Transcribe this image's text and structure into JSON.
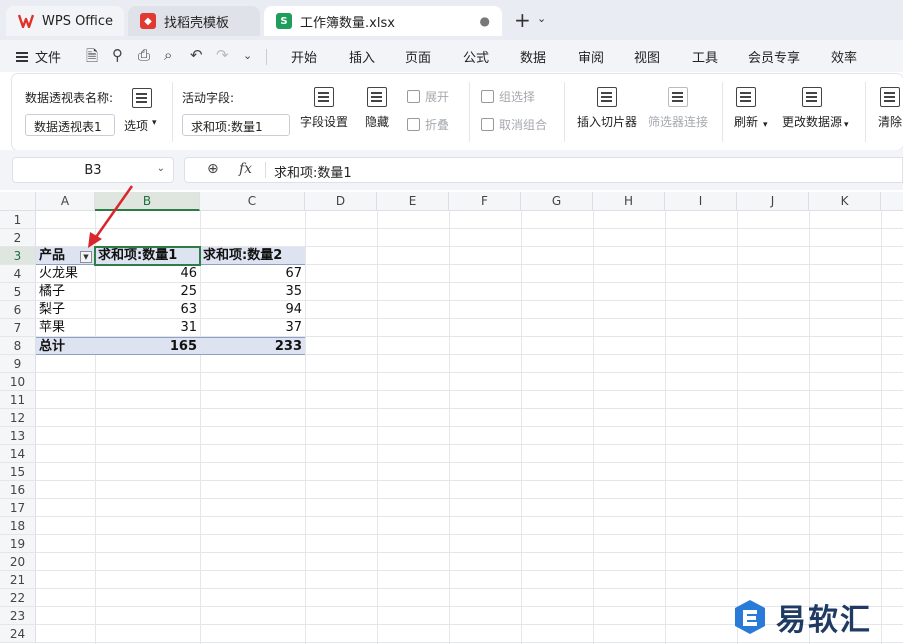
{
  "tabs": [
    {
      "label": "WPS Office",
      "icon": "wps-logo-icon"
    },
    {
      "label": "找稻壳模板",
      "icon": "docer-icon"
    },
    {
      "label": "工作簿数量.xlsx",
      "icon": "spreadsheet-s-icon",
      "badge": "S"
    }
  ],
  "menu": {
    "file": "文件",
    "items": [
      "开始",
      "插入",
      "页面",
      "公式",
      "数据",
      "审阅",
      "视图",
      "工具",
      "会员专享",
      "效率"
    ]
  },
  "ribbon": {
    "pivot_name_label": "数据透视表名称:",
    "pivot_name_value": "数据透视表1",
    "options_label": "选项",
    "active_field_label": "活动字段:",
    "active_field_value": "求和项:数量1",
    "field_settings": "字段设置",
    "hide": "隐藏",
    "expand": "展开",
    "collapse": "折叠",
    "group_selection": "组选择",
    "ungroup": "取消组合",
    "insert_slicer": "插入切片器",
    "filter_connections": "筛选器连接",
    "refresh": "刷新",
    "change_source": "更改数据源",
    "clear": "清除"
  },
  "formula_bar": {
    "cell_ref": "B3",
    "fx": "fx",
    "content": "求和项:数量1"
  },
  "columns": [
    "A",
    "B",
    "C",
    "D",
    "E",
    "F",
    "G",
    "H",
    "I",
    "J",
    "K"
  ],
  "rows": [
    "1",
    "2",
    "3",
    "4",
    "5",
    "6",
    "7",
    "8",
    "9",
    "10",
    "11",
    "12",
    "13",
    "14",
    "15",
    "16",
    "17",
    "18",
    "19",
    "20",
    "21",
    "22",
    "23",
    "24"
  ],
  "pivot": {
    "header": {
      "a": "产品",
      "b": "求和项:数量1",
      "c": "求和项:数量2"
    },
    "data": [
      {
        "a": "火龙果",
        "b": "46",
        "c": "67"
      },
      {
        "a": "橘子",
        "b": "25",
        "c": "35"
      },
      {
        "a": "梨子",
        "b": "63",
        "c": "94"
      },
      {
        "a": "苹果",
        "b": "31",
        "c": "37"
      }
    ],
    "total": {
      "a": "总计",
      "b": "165",
      "c": "233"
    }
  },
  "watermark": "易软汇",
  "colors": {
    "accent_green": "#2e7d46",
    "pivot_blue": "#dde3f0",
    "annotation_red": "#d9262c"
  }
}
